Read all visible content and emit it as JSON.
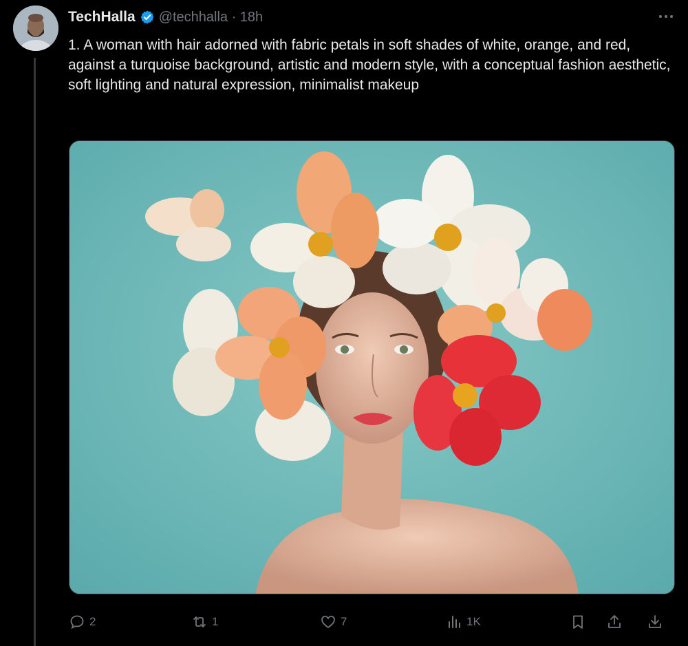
{
  "tweet": {
    "display_name": "TechHalla",
    "handle_time": "@techhalla · 18h",
    "text": "1. A woman with hair adorned with fabric petals in soft shades of white, orange, and red, against a turquoise background, artistic and modern style, with a conceptual fashion aesthetic, soft lighting and natural expression, minimalist makeup"
  },
  "icons": {
    "verified": "verified-badge-icon",
    "more": "more-icon",
    "reply": "reply-icon",
    "repost": "repost-icon",
    "like": "like-icon",
    "views": "views-icon",
    "bookmark": "bookmark-icon",
    "share": "share-icon",
    "download": "download-icon"
  },
  "actions": {
    "reply_count": "2",
    "repost_count": "1",
    "like_count": "7",
    "views_count": "1K"
  },
  "colors": {
    "background": "#000000",
    "text": "#e7e9ea",
    "muted": "#71767b",
    "verified": "#1d9bf0",
    "media_bg": "#6fb8b8"
  }
}
